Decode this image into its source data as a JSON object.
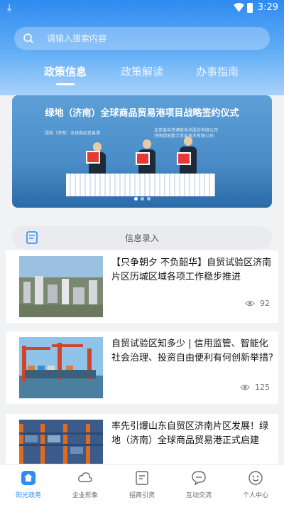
{
  "status": {
    "time": "3:29"
  },
  "search": {
    "placeholder": "请输入搜索内容",
    "icon": "search-icon"
  },
  "tabs": [
    {
      "label": "政策信息",
      "active": true
    },
    {
      "label": "政策解读",
      "active": false
    },
    {
      "label": "办事指南",
      "active": false
    }
  ],
  "banner": {
    "title": "绿地（济南）全球商品贸易港项目战略签约仪式",
    "left_caption": "绿地（济南）全球商品贸易港",
    "right_caption_1": "北京某中资港联技术股份有限公司",
    "right_caption_2": "济南绿地数字贸易技术有限公司",
    "page_count": 3,
    "current_page": 1
  },
  "info_bar": {
    "label": "信息录入",
    "icon": "form-icon"
  },
  "news": [
    {
      "title": "【只争朝夕 不负韶华】自贸试验区济南片区历城区域各项工作稳步推进",
      "views": "92"
    },
    {
      "title": "自贸试验区知多少 | 信用监管、智能化社会治理、投资自由便利有何创新举措?",
      "views": "125"
    },
    {
      "title": "率先引爆山东自贸区济南片区发展！绿地（济南）全球商品贸易港正式启建",
      "views": ""
    }
  ],
  "nav": [
    {
      "label": "阳光政务",
      "icon": "home-icon",
      "active": true
    },
    {
      "label": "企业形象",
      "icon": "cloud-icon",
      "active": false
    },
    {
      "label": "招商引资",
      "icon": "document-icon",
      "active": false
    },
    {
      "label": "互动交流",
      "icon": "chat-icon",
      "active": false
    },
    {
      "label": "个人中心",
      "icon": "smile-icon",
      "active": false
    }
  ],
  "colors": {
    "accent": "#2f8bf0"
  }
}
